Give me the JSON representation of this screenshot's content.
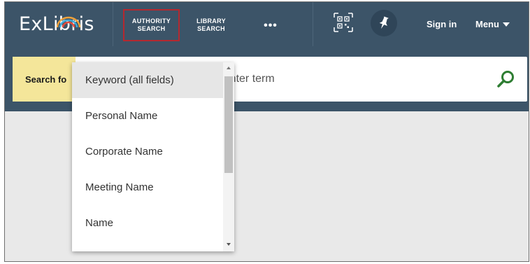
{
  "brand": {
    "logo_text": "ExLibris"
  },
  "nav": {
    "authority_line1": "AUTHORITY",
    "authority_line2": "SEARCH",
    "library_line1": "LIBRARY",
    "library_line2": "SEARCH",
    "more": "•••",
    "sign_in": "Sign in",
    "menu": "Menu"
  },
  "search": {
    "label": "Search fo",
    "placeholder": "Enter term",
    "button_icon": "search-icon"
  },
  "dropdown": {
    "options": [
      {
        "label": "Keyword (all fields)",
        "selected": true
      },
      {
        "label": "Personal Name",
        "selected": false
      },
      {
        "label": "Corporate Name",
        "selected": false
      },
      {
        "label": "Meeting Name",
        "selected": false
      },
      {
        "label": "Name",
        "selected": false
      }
    ]
  },
  "colors": {
    "header_bg": "#3c5468",
    "search_label_bg": "#f4e69a",
    "active_nav_border": "#b5282f",
    "search_icon": "#2e7d32"
  }
}
